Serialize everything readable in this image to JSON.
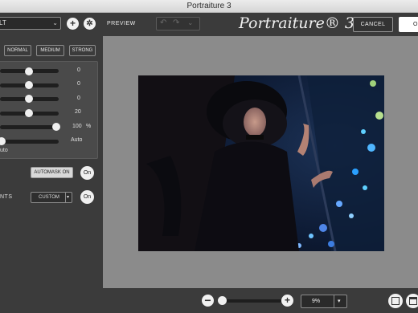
{
  "window": {
    "title": "Portraiture 3"
  },
  "sidebar": {
    "preset_value": "LT",
    "levels": [
      "NORMAL",
      "MEDIUM",
      "STRONG"
    ],
    "sliders": [
      {
        "value": "0",
        "level": 0.5
      },
      {
        "value": "0",
        "level": 0.5
      },
      {
        "value": "0",
        "level": 0.5
      },
      {
        "value": "20",
        "level": 0.5
      },
      {
        "value": "100",
        "unit": "%",
        "level": 1.0
      },
      {
        "value": "Auto",
        "level": 0.0
      }
    ],
    "auto_left_label": "uto",
    "automask_label": "AUTOMASK ON",
    "mask_on_label": "On",
    "enhance_label": "NTS",
    "custom_label": "CUSTOM",
    "enhance_on_label": "On"
  },
  "toolbar": {
    "preview_label": "PREVIEW",
    "brand_text": "Portraiture® 3",
    "cancel_label": "CANCEL",
    "ok_label": "O"
  },
  "bottom": {
    "zoom_value": "9%",
    "zoom_level": 0.0
  }
}
